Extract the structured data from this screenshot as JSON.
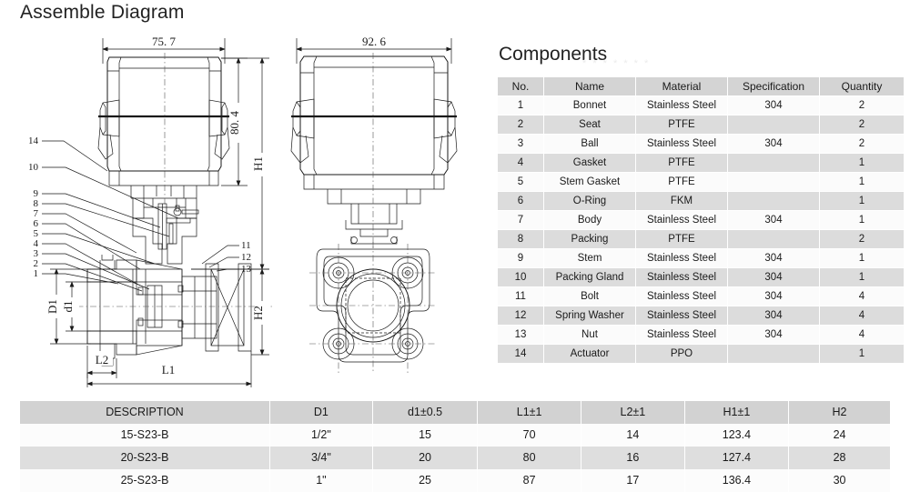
{
  "page": {
    "assemble_title": "Assemble Diagram",
    "components_title": "Components",
    "components_watermark": "* * * * * * *"
  },
  "drawing": {
    "front_view": {
      "width_dim": "75. 7",
      "height_dim": "80. 4",
      "h1_label": "H1",
      "h2_label": "H2",
      "d1_label": "D1",
      "d1_small_label": "d1",
      "l1_label": "L1",
      "l2_label": "L2",
      "callouts_left": [
        "14",
        "10",
        "9",
        "8",
        "7",
        "6",
        "5",
        "4",
        "3",
        "2",
        "1"
      ],
      "callouts_right": [
        "11",
        "12",
        "13"
      ]
    },
    "side_view": {
      "width_dim": "92. 6"
    }
  },
  "components_table": {
    "headers": [
      "No.",
      "Name",
      "Material",
      "Specification",
      "Quantity"
    ],
    "rows": [
      [
        "1",
        "Bonnet",
        "Stainless Steel",
        "304",
        "2"
      ],
      [
        "2",
        "Seat",
        "PTFE",
        "",
        "2"
      ],
      [
        "3",
        "Ball",
        "Stainless Steel",
        "304",
        "2"
      ],
      [
        "4",
        "Gasket",
        "PTFE",
        "",
        "1"
      ],
      [
        "5",
        "Stem Gasket",
        "PTFE",
        "",
        "1"
      ],
      [
        "6",
        "O-Ring",
        "FKM",
        "",
        "1"
      ],
      [
        "7",
        "Body",
        "Stainless Steel",
        "304",
        "1"
      ],
      [
        "8",
        "Packing",
        "PTFE",
        "",
        "2"
      ],
      [
        "9",
        "Stem",
        "Stainless Steel",
        "304",
        "1"
      ],
      [
        "10",
        "Packing Gland",
        "Stainless Steel",
        "304",
        "1"
      ],
      [
        "11",
        "Bolt",
        "Stainless Steel",
        "304",
        "4"
      ],
      [
        "12",
        "Spring Washer",
        "Stainless Steel",
        "304",
        "4"
      ],
      [
        "13",
        "Nut",
        "Stainless Steel",
        "304",
        "4"
      ],
      [
        "14",
        "Actuator",
        "PPO",
        "",
        "1"
      ]
    ]
  },
  "spec_table": {
    "headers": [
      "DESCRIPTION",
      "D1",
      "d1±0.5",
      "L1±1",
      "L2±1",
      "H1±1",
      "H2"
    ],
    "rows": [
      [
        "15-S23-B",
        "1/2\"",
        "15",
        "70",
        "14",
        "123.4",
        "24"
      ],
      [
        "20-S23-B",
        "3/4\"",
        "20",
        "80",
        "16",
        "127.4",
        "28"
      ],
      [
        "25-S23-B",
        "1\"",
        "25",
        "87",
        "17",
        "136.4",
        "30"
      ]
    ]
  }
}
